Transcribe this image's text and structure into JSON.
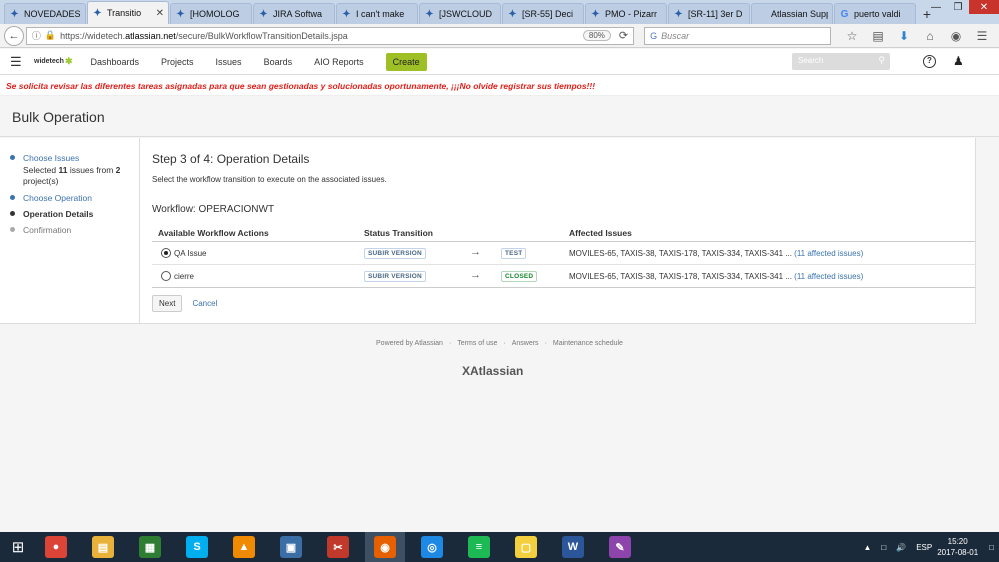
{
  "browser": {
    "tabs": [
      {
        "label": "NOVEDADES",
        "icon": "jira-icon",
        "active": false
      },
      {
        "label": "Transitio",
        "icon": "jira-icon",
        "active": true
      },
      {
        "label": "[HOMOLOG",
        "icon": "jira-icon",
        "active": false
      },
      {
        "label": "JIRA Softwa",
        "icon": "jira-icon",
        "active": false
      },
      {
        "label": "I can't make",
        "icon": "jira-icon",
        "active": false
      },
      {
        "label": "[JSWCLOUD",
        "icon": "jira-icon",
        "active": false
      },
      {
        "label": "[SR-55] Deci",
        "icon": "jira-icon",
        "active": false
      },
      {
        "label": "PMO - Pizarr",
        "icon": "jira-icon",
        "active": false
      },
      {
        "label": "[SR-11] 3er D",
        "icon": "jira-icon",
        "active": false
      },
      {
        "label": "Atlassian Suppo",
        "icon": "none",
        "active": false
      },
      {
        "label": "puerto valdi",
        "icon": "google-icon",
        "active": false
      }
    ],
    "url_prefix": "https://widetech.",
    "url_domain": "atlassian.net",
    "url_path": "/secure/BulkWorkflowTransitionDetails.jspa",
    "zoom": "80%",
    "search_placeholder": "Buscar"
  },
  "jira": {
    "logo_text": "widetech",
    "nav": [
      "Dashboards",
      "Projects",
      "Issues",
      "Boards",
      "AIO Reports"
    ],
    "create_label": "Create",
    "search_placeholder": "Search",
    "announcement": "Se solicita revisar las diferentes tareas asignadas para que sean gestionadas y solucionadas oportunamente, ¡¡¡No olvide registrar sus tiempos!!!",
    "page_title": "Bulk Operation"
  },
  "wizard": {
    "steps": [
      {
        "label": "Choose Issues",
        "state": "done",
        "desc_pre": "Selected ",
        "desc_count": "11",
        "desc_mid": " issues from ",
        "desc_count2": "2",
        "desc_post": " project(s)"
      },
      {
        "label": "Choose Operation",
        "state": "done"
      },
      {
        "label": "Operation Details",
        "state": "current"
      },
      {
        "label": "Confirmation",
        "state": "pending"
      }
    ]
  },
  "main": {
    "heading": "Step 3 of 4: Operation Details",
    "description": "Select the workflow transition to execute on the associated issues.",
    "workflow_label": "Workflow: OPERACIONWT",
    "columns": [
      "Available Workflow Actions",
      "Status Transition",
      "Affected Issues"
    ],
    "rows": [
      {
        "action": "QA Issue",
        "checked": true,
        "from": "SUBIR VERSION",
        "to": "TEST",
        "to_color": "blue",
        "issues": "MOVILES-65, TAXIS-38, TAXIS-178, TAXIS-334, TAXIS-341 ...",
        "affected_link": "(11 affected issues)"
      },
      {
        "action": "cierre",
        "checked": false,
        "from": "SUBIR VERSION",
        "to": "CLOSED",
        "to_color": "green",
        "issues": "MOVILES-65, TAXIS-38, TAXIS-178, TAXIS-334, TAXIS-341 ...",
        "affected_link": "(11 affected issues)"
      }
    ],
    "next_label": "Next",
    "cancel_label": "Cancel"
  },
  "footer": {
    "links": [
      "Powered by Atlassian",
      "Terms of use",
      "Answers",
      "Maintenance schedule"
    ],
    "logo_text": "Atlassian"
  },
  "taskbar": {
    "apps": [
      "chrome-icon",
      "file-explorer-icon",
      "spreadsheet-icon",
      "skype-icon",
      "vlc-icon",
      "remote-desktop-icon",
      "snipping-tool-icon",
      "firefox-icon",
      "camera-icon",
      "spotify-icon",
      "sticky-notes-icon",
      "word-icon",
      "paint-icon"
    ],
    "active_app": "firefox-icon",
    "lang": "ESP",
    "time": "15:20",
    "date": "2017-08-01"
  }
}
